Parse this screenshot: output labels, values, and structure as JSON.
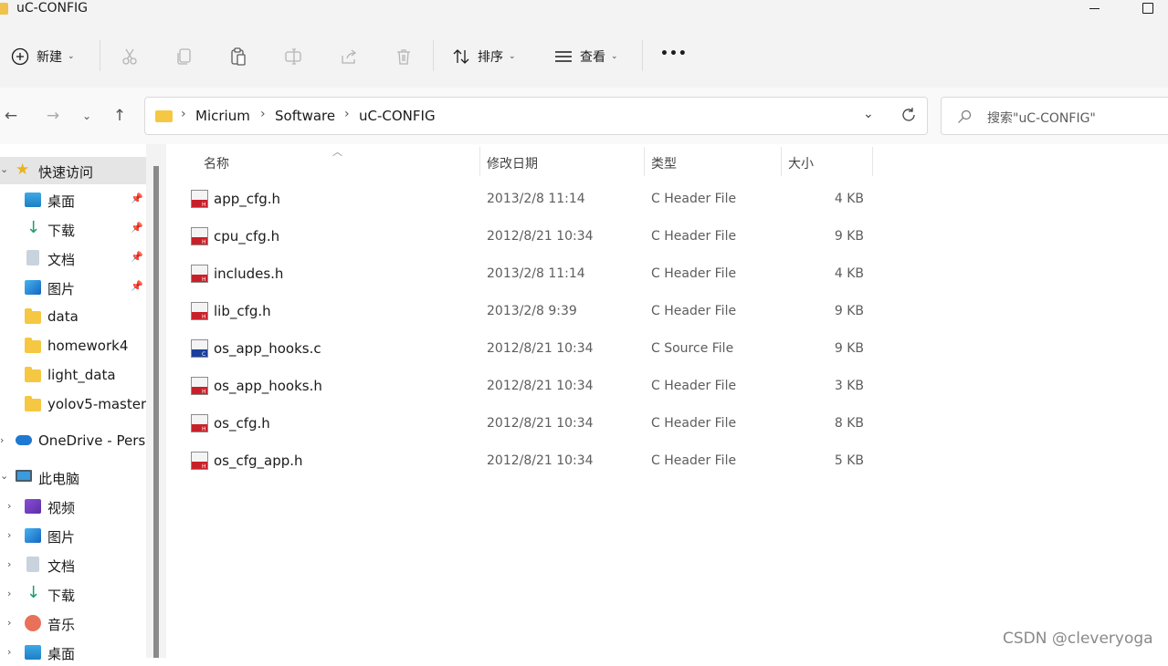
{
  "window": {
    "title": "uC-CONFIG"
  },
  "toolbar": {
    "new_label": "新建",
    "sort_label": "排序",
    "view_label": "查看",
    "more_label": "•••"
  },
  "address": {
    "crumbs": [
      "Micrium",
      "Software",
      "uC-CONFIG"
    ],
    "search_placeholder": "搜索\"uC-CONFIG\""
  },
  "sidebar": {
    "items": [
      {
        "label": "快速访问"
      },
      {
        "label": "桌面"
      },
      {
        "label": "下载"
      },
      {
        "label": "文档"
      },
      {
        "label": "图片"
      },
      {
        "label": "data"
      },
      {
        "label": "homework4"
      },
      {
        "label": "light_data"
      },
      {
        "label": "yolov5-master"
      },
      {
        "label": "OneDrive - Perso"
      },
      {
        "label": "此电脑"
      },
      {
        "label": "视频"
      },
      {
        "label": "图片"
      },
      {
        "label": "文档"
      },
      {
        "label": "下载"
      },
      {
        "label": "音乐"
      },
      {
        "label": "桌面"
      }
    ]
  },
  "columns": {
    "name": "名称",
    "modified": "修改日期",
    "type": "类型",
    "size": "大小"
  },
  "files": [
    {
      "name": "app_cfg.h",
      "modified": "2013/2/8 11:14",
      "type": "C Header File",
      "size": "4 KB",
      "icon": "h-file-icon"
    },
    {
      "name": "cpu_cfg.h",
      "modified": "2012/8/21 10:34",
      "type": "C Header File",
      "size": "9 KB",
      "icon": "h-file-icon"
    },
    {
      "name": "includes.h",
      "modified": "2013/2/8 11:14",
      "type": "C Header File",
      "size": "4 KB",
      "icon": "h-file-icon"
    },
    {
      "name": "lib_cfg.h",
      "modified": "2013/2/8 9:39",
      "type": "C Header File",
      "size": "9 KB",
      "icon": "h-file-icon"
    },
    {
      "name": "os_app_hooks.c",
      "modified": "2012/8/21 10:34",
      "type": "C Source File",
      "size": "9 KB",
      "icon": "c-file-icon"
    },
    {
      "name": "os_app_hooks.h",
      "modified": "2012/8/21 10:34",
      "type": "C Header File",
      "size": "3 KB",
      "icon": "h-file-icon"
    },
    {
      "name": "os_cfg.h",
      "modified": "2012/8/21 10:34",
      "type": "C Header File",
      "size": "8 KB",
      "icon": "h-file-icon"
    },
    {
      "name": "os_cfg_app.h",
      "modified": "2012/8/21 10:34",
      "type": "C Header File",
      "size": "5 KB",
      "icon": "h-file-icon"
    }
  ],
  "watermark": "CSDN @cleveryoga",
  "colors": {
    "folder": "#f5c742",
    "header_red": "#c8202a",
    "source_blue": "#1c3f9e",
    "selection": "#e5e5e5"
  }
}
